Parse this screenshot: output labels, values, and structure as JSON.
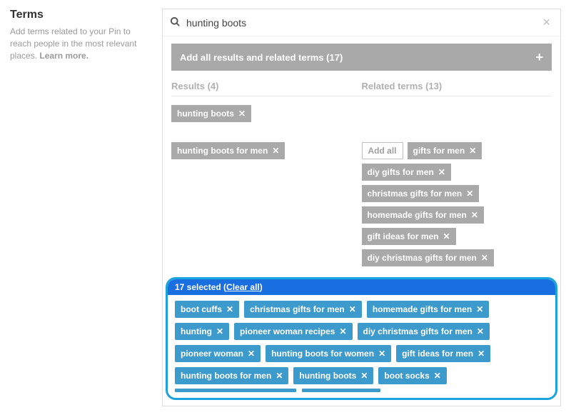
{
  "sidebar": {
    "title": "Terms",
    "description_prefix": "Add terms related to your Pin to reach people in the most relevant places. ",
    "learn_more": "Learn more."
  },
  "search": {
    "value": "hunting boots",
    "clear_glyph": "×"
  },
  "add_all_bar": {
    "label": "Add all results and related terms (17)",
    "plus_glyph": "+"
  },
  "headers": {
    "results": "Results (4)",
    "related": "Related terms (13)"
  },
  "rows": [
    {
      "left": [
        {
          "label": "hunting boots"
        }
      ],
      "right": []
    },
    {
      "left": [
        {
          "label": "hunting boots for men"
        }
      ],
      "right_add_all": "Add all",
      "right": [
        {
          "label": "gifts for men"
        },
        {
          "label": "diy gifts for men"
        },
        {
          "label": "christmas gifts for men"
        },
        {
          "label": "homemade gifts for men"
        },
        {
          "label": "gift ideas for men"
        },
        {
          "label": "diy christmas gifts for men"
        }
      ]
    }
  ],
  "selected": {
    "count_label": "17 selected (",
    "clear_all": "Clear all",
    "close_paren": ")",
    "tags": [
      "boot cuffs",
      "christmas gifts for men",
      "homemade gifts for men",
      "hunting",
      "pioneer woman recipes",
      "diy christmas gifts for men",
      "pioneer woman",
      "hunting boots for women",
      "gift ideas for men",
      "hunting boots for men",
      "hunting boots",
      "boot socks"
    ]
  },
  "icons": {
    "remove_x": "✕"
  }
}
